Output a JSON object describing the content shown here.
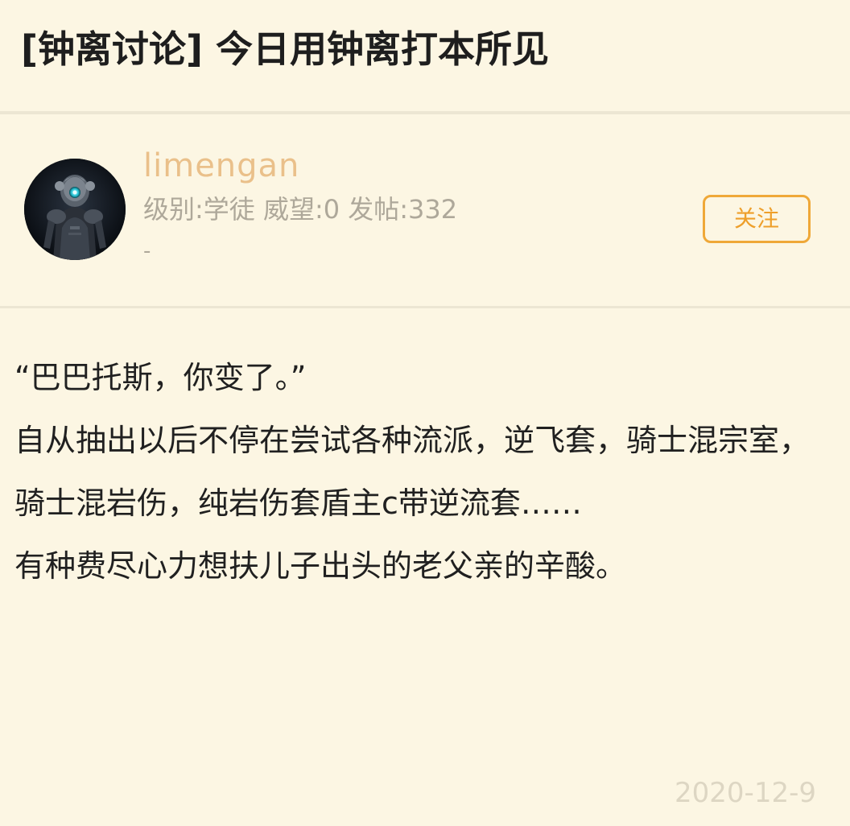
{
  "post": {
    "title": "[钟离讨论] 今日用钟离打本所见",
    "date": "2020-12-9",
    "paragraphs": [
      "“巴巴托斯，你变了。”",
      "",
      "自从抽出以后不停在尝试各种流派，逆飞套，骑士混宗室，骑士混岩伤，纯岩伤套盾主c带逆流套……",
      "有种费尽心力想扶儿子出头的老父亲的辛酸。"
    ]
  },
  "author": {
    "username": "limengan",
    "meta": "级别:学徒 威望:0 发帖:332",
    "signature": "-",
    "avatar_icon": "armored-soldier-avatar",
    "follow_label": "关注"
  },
  "colors": {
    "background": "#fcf6e3",
    "username": "#eac08a",
    "accent": "#ee9f2a",
    "meta_text": "#aea89a",
    "divider": "#ece6d3"
  }
}
